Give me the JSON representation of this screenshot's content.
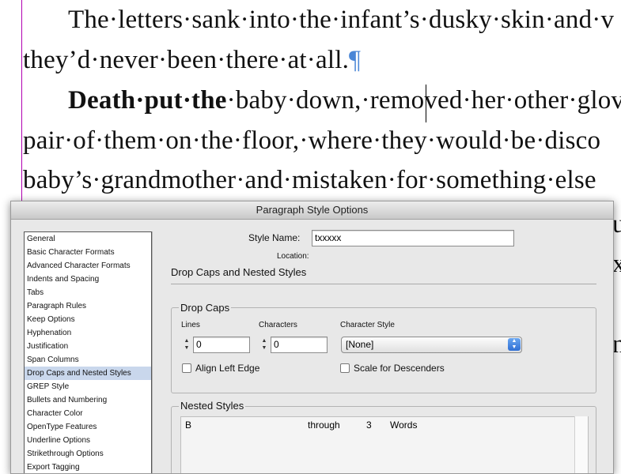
{
  "document": {
    "line1": "The·letters·sank·into·the·infant’s·dusky·skin·and·v",
    "line2": "they’d·never·been·there·at·all.",
    "line2_pilcrow": "¶",
    "line3_bold": "Death·put·the",
    "line3_rest": "·baby·down,·removed·her·other·glov",
    "line4": "pair·of·them·on·the·floor,·where·they·would·be·disco",
    "line5": "baby’s·grandmother·and·mistaken·for·something·else",
    "frag1": "u",
    "frag2": "x",
    "frag3": "ne"
  },
  "dialog": {
    "title": "Paragraph Style Options",
    "sidebar": [
      {
        "label": "General"
      },
      {
        "label": "Basic Character Formats"
      },
      {
        "label": "Advanced Character Formats"
      },
      {
        "label": "Indents and Spacing"
      },
      {
        "label": "Tabs"
      },
      {
        "label": "Paragraph Rules"
      },
      {
        "label": "Keep Options"
      },
      {
        "label": "Hyphenation"
      },
      {
        "label": "Justification"
      },
      {
        "label": "Span Columns"
      },
      {
        "label": "Drop Caps and Nested Styles",
        "selected": true
      },
      {
        "label": "GREP Style"
      },
      {
        "label": "Bullets and Numbering"
      },
      {
        "label": "Character Color"
      },
      {
        "label": "OpenType Features"
      },
      {
        "label": "Underline Options"
      },
      {
        "label": "Strikethrough Options"
      },
      {
        "label": "Export Tagging"
      }
    ],
    "style_name_label": "Style Name:",
    "style_name_value": "txxxxx",
    "location_label": "Location:",
    "section_title": "Drop Caps and Nested Styles",
    "drop_caps": {
      "legend": "Drop Caps",
      "lines_label": "Lines",
      "lines_value": "0",
      "characters_label": "Characters",
      "characters_value": "0",
      "char_style_label": "Character Style",
      "char_style_value": "[None]",
      "align_left_edge": "Align Left Edge",
      "scale_descenders": "Scale for Descenders"
    },
    "nested_styles": {
      "legend": "Nested Styles",
      "row": {
        "style": "B",
        "type": "through",
        "count": "3",
        "unit": "Words"
      }
    }
  }
}
